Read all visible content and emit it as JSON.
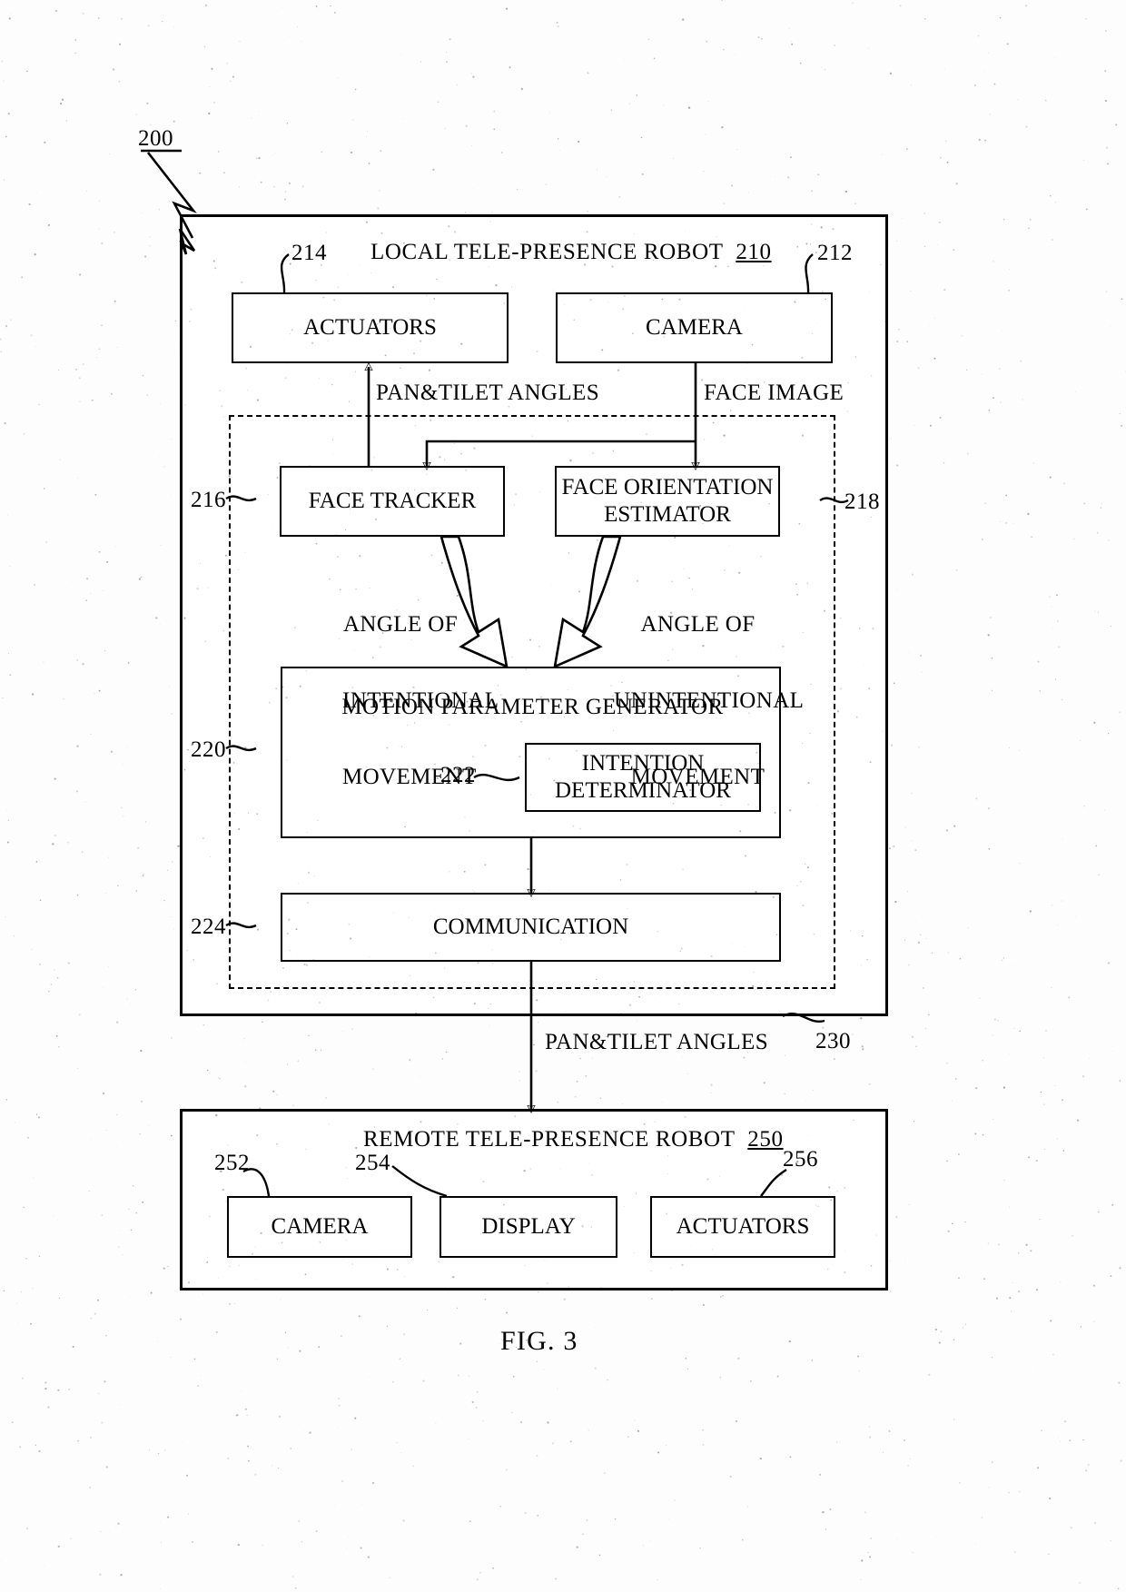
{
  "figure": {
    "caption": "FIG. 3",
    "system_ref": "200"
  },
  "local_robot": {
    "title": "LOCAL TELE-PRESENCE ROBOT",
    "ref": "210",
    "actuators": {
      "label": "ACTUATORS",
      "ref": "214"
    },
    "camera": {
      "label": "CAMERA",
      "ref": "212"
    },
    "face_tracker": {
      "label": "FACE TRACKER",
      "ref": "216"
    },
    "face_orientation_estimator": {
      "label_line1": "FACE ORIENTATION",
      "label_line2": "ESTIMATOR",
      "ref": "218"
    },
    "motion_parameter_generator": {
      "label": "MOTION PARAMETER GENERATOR",
      "ref": "220"
    },
    "intention_determinator": {
      "label_line1": "INTENTION",
      "label_line2": "DETERMINATOR",
      "ref": "222"
    },
    "communication": {
      "label": "COMMUNICATION",
      "ref": "224"
    },
    "controller_ref": "230"
  },
  "remote_robot": {
    "title": "REMOTE TELE-PRESENCE ROBOT",
    "ref": "250",
    "camera": {
      "label": "CAMERA",
      "ref": "252"
    },
    "display": {
      "label": "DISPLAY",
      "ref": "254"
    },
    "actuators": {
      "label": "ACTUATORS",
      "ref": "256"
    }
  },
  "edge_labels": {
    "pan_tilt_up": "PAN&TILET ANGLES",
    "face_image": "FACE IMAGE",
    "angle_intentional_l1": "ANGLE OF",
    "angle_intentional_l2": "INTENTIONAL",
    "angle_intentional_l3": "MOVEMENT",
    "angle_unintentional_l1": "ANGLE OF",
    "angle_unintentional_l2": "UNINTENTIONAL",
    "angle_unintentional_l3": "MOVEMENT",
    "pan_tilt_down": "PAN&TILET ANGLES"
  }
}
